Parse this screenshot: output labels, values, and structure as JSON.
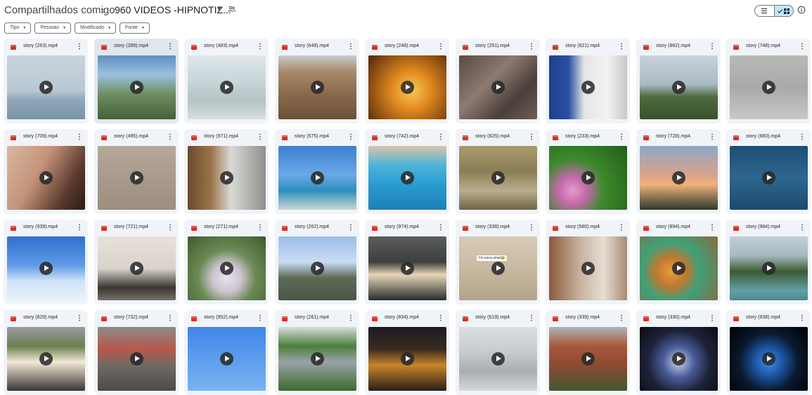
{
  "breadcrumb": {
    "root": "Compartilhados comigo",
    "separator": "›",
    "folder": "960 VIDEOS -HIPNOTIZ..."
  },
  "icons": {
    "shared": "shared-people-icon",
    "view_list": "list-view-icon",
    "view_grid": "grid-view-icon",
    "info": "info-icon",
    "file_type": "video-file-icon",
    "more": "more-vert-icon",
    "play": "play-icon"
  },
  "filters": [
    {
      "label": "Tipo"
    },
    {
      "label": "Pessoas"
    },
    {
      "label": "Modificado"
    },
    {
      "label": "Fonte"
    }
  ],
  "colors": {
    "accent_selected": "#c2e7ff",
    "video_icon": "#d93025",
    "card_bg": "#f0f4f9"
  },
  "files": [
    {
      "name": "story (263).mp4",
      "thumb": "linear-gradient(180deg,#c9d3dc 0%,#b9c7d3 55%,#8ea6b9 70%,#7893a6 100%)"
    },
    {
      "name": "story (289).mp4",
      "thumb": "linear-gradient(180deg,#5f8fbf 0%,#9cc0de 30%,#6f8f63 60%,#44603a 100%)",
      "selected": true
    },
    {
      "name": "story (483).mp4",
      "thumb": "linear-gradient(180deg,#dfe6e8 0%,#c9d6da 40%,#b4c3c4 70%,#d9dfdd 100%)"
    },
    {
      "name": "story (648).mp4",
      "thumb": "linear-gradient(180deg,#c7ccd0 0%,#a88b6a 25%,#8a6a4b 60%,#6c513a 100%)"
    },
    {
      "name": "story (248).mp4",
      "thumb": "radial-gradient(circle at 55% 55%,#f7c85a 0%,#e08a1f 35%,#8a4a10 75%,#4a2708 100%)"
    },
    {
      "name": "story (291).mp4",
      "thumb": "linear-gradient(135deg,#5a4a44 0%,#8c7a70 40%,#4b3f3a 70%,#6d5d55 100%)"
    },
    {
      "name": "story (821).mp4",
      "thumb": "linear-gradient(90deg,#1e3f8c 0%,#2c4fa3 25%,#e5e5e5 45%,#f2f2f2 75%,#c8c8c8 100%)"
    },
    {
      "name": "story (882).mp4",
      "thumb": "linear-gradient(180deg,#c8d2da 0%,#aab9c6 45%,#4d6b3c 65%,#39502d 100%)"
    },
    {
      "name": "story (748).mp4",
      "thumb": "linear-gradient(180deg,#b7b9b6 0%,#a7aaa7 50%,#c8c9c6 100%)"
    },
    {
      "name": "story (709).mp4",
      "thumb": "linear-gradient(120deg,#d9b7a4 0%,#c49379 40%,#5a3a2e 75%,#2c1b15 100%)"
    },
    {
      "name": "story (495).mp4",
      "thumb": "linear-gradient(180deg,#b5a79a 0%,#a89a8c 50%,#9c8d7f 100%)"
    },
    {
      "name": "story (971).mp4",
      "thumb": "linear-gradient(90deg,#6b4a2d 0%,#9b7449 30%,#d9d9d6 55%,#8f8f8c 100%)"
    },
    {
      "name": "story (575).mp4",
      "thumb": "linear-gradient(180deg,#3c7fd0 0%,#6aa8e6 45%,#2f8fbf 70%,#c9d7cf 100%)"
    },
    {
      "name": "story (742).mp4",
      "thumb": "linear-gradient(180deg,#d7c6a8 0%,#4fb3d9 30%,#2a9cd0 60%,#1c7fb8 100%)"
    },
    {
      "name": "story (825).mp4",
      "thumb": "linear-gradient(180deg,#a99b6c 0%,#8a7d55 40%,#b9ad8f 70%,#6e6446 100%)"
    },
    {
      "name": "story (233).mp4",
      "thumb": "radial-gradient(circle at 30% 70%,#e89ad0 0%,#c16aa8 20%,#3d8a2c 45%,#235c19 100%)"
    },
    {
      "name": "story (728).mp4",
      "thumb": "linear-gradient(180deg,#8fa7c7 0%,#d7a38c 45%,#f0b27a 60%,#2d3a2b 100%)"
    },
    {
      "name": "story (660).mp4",
      "thumb": "linear-gradient(180deg,#1f4e73 0%,#2d6690 50%,#1d4a6d 100%)"
    },
    {
      "name": "story (939).mp4",
      "thumb": "linear-gradient(180deg,#2f6fcf 0%,#5f9be6 45%,#cfe2f7 70%,#e8f1fb 100%)"
    },
    {
      "name": "story (721).mp4",
      "thumb": "linear-gradient(180deg,#e6e1da 0%,#d9d3cb 50%,#3a3631 80%,#77706a 100%)"
    },
    {
      "name": "story (271).mp4",
      "thumb": "radial-gradient(circle at 50% 65%,#e8e2ea 0%,#cfc3d2 25%,#6b8a55 50%,#3f5a2e 100%)"
    },
    {
      "name": "story (262).mp4",
      "thumb": "linear-gradient(180deg,#9cbde8 0%,#c9dcf2 40%,#5d6b55 65%,#4a5545 100%)"
    },
    {
      "name": "story (974).mp4",
      "thumb": "linear-gradient(180deg,#5b5d5c 0%,#3d3f3e 40%,#e6d6b8 60%,#2a2c2b 100%)"
    },
    {
      "name": "story (338).mp4",
      "thumb": "linear-gradient(180deg,#d7cbb8 0%,#c8b9a1 50%,#b3a389 100%)",
      "caption": "I'm sorry what😂"
    },
    {
      "name": "story (580).mp4",
      "thumb": "linear-gradient(90deg,#8a5a3c 0%,#c8b3a0 40%,#e7ddd2 70%,#a88a73 100%)"
    },
    {
      "name": "story (894).mp4",
      "thumb": "radial-gradient(circle at 40% 55%,#e0a040 0%,#c07830 25%,#3fa07a 50%,#8a6a3a 100%)"
    },
    {
      "name": "story (984).mp4",
      "thumb": "linear-gradient(180deg,#c2cfd7 0%,#a7b8c0 30%,#3c5a34 55%,#63a0a8 85%,#4a8a8f 100%)"
    },
    {
      "name": "story (829).mp4",
      "thumb": "linear-gradient(180deg,#9a9da3 0%,#6a7f4d 30%,#f2e8d8 55%,#3a3434 100%)"
    },
    {
      "name": "story (732).mp4",
      "thumb": "linear-gradient(180deg,#8a8c88 0%,#b8574a 35%,#6f6a64 60%,#4e4a46 100%)"
    },
    {
      "name": "story (952).mp4",
      "thumb": "linear-gradient(180deg,#3f86e6 0%,#5c9ded 50%,#79b3f2 100%)"
    },
    {
      "name": "story (261).mp4",
      "thumb": "linear-gradient(180deg,#d8dcdc 0%,#4c7f3c 30%,#9aa3a8 55%,#3c6a2e 100%)"
    },
    {
      "name": "story (834).mp4",
      "thumb": "linear-gradient(180deg,#1a1a22 0%,#3a2c20 35%,#c9852c 60%,#2a1e18 100%)"
    },
    {
      "name": "story (619).mp4",
      "thumb": "linear-gradient(180deg,#dcdfe1 0%,#c7cbce 40%,#a9adaf 70%,#d6d9da 100%)"
    },
    {
      "name": "story (339).mp4",
      "thumb": "linear-gradient(180deg,#b0b4b8 0%,#a8583c 30%,#8d4a33 60%,#3e5a30 100%)"
    },
    {
      "name": "story (330).mp4",
      "thumb": "radial-gradient(circle at 50% 55%,#c9d4e6 0%,#4a5c9a 30%,#1d2238 60%,#0b0d14 100%)"
    },
    {
      "name": "story (938).mp4",
      "thumb": "radial-gradient(circle at 50% 55%,#3a8fe0 0%,#1e5aa8 25%,#0a1a30 55%,#000000 100%)"
    }
  ]
}
